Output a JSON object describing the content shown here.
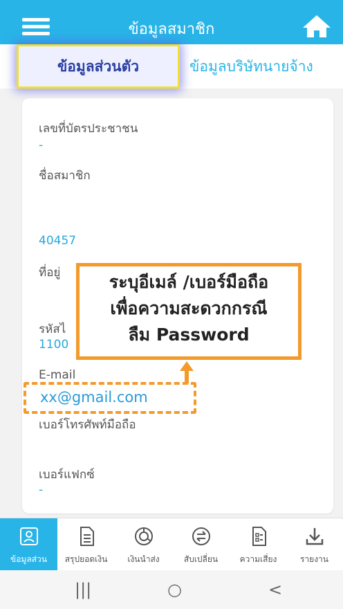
{
  "header": {
    "title": "ข้อมูลสมาชิก"
  },
  "tabs": [
    {
      "label": "ข้อมูลส่วนตัว"
    },
    {
      "label": "ข้อมูลบริษัทนายจ้าง"
    }
  ],
  "fields": {
    "id_card": {
      "label": "เลขที่บัตรประชาชน",
      "value": "-"
    },
    "member_name": {
      "label": "ชื่อสมาชิก",
      "value": "40457"
    },
    "address": {
      "label": "ที่อยู่"
    },
    "postal": {
      "label": "รหัสไ",
      "value": "1100"
    },
    "email": {
      "label": "E-mail",
      "value": "xx@gmail.com"
    },
    "mobile": {
      "label": "เบอร์โทรศัพท์มือถือ"
    },
    "fax": {
      "label": "เบอร์แฟกซ์",
      "value": "-"
    }
  },
  "callout": {
    "line1": "ระบุอีเมล์ /เบอร์มือถือ",
    "line2": "เพื่อความสะดวกกรณี",
    "line3": "ลืม Password"
  },
  "bottom_nav": [
    {
      "label": "ข้อมูลส่วน",
      "icon": "profile-card-icon"
    },
    {
      "label": "สรุปยอดเงิน",
      "icon": "document-icon"
    },
    {
      "label": "เงินนำส่ง",
      "icon": "pie-chart-icon"
    },
    {
      "label": "สับเปลี่ยน",
      "icon": "switch-icon"
    },
    {
      "label": "ความเสี่ยง",
      "icon": "risk-document-icon"
    },
    {
      "label": "รายงาน",
      "icon": "download-icon"
    }
  ],
  "system_nav": {
    "recents": "|||",
    "home": "○",
    "back": "<"
  },
  "colors": {
    "primary": "#29b4e8",
    "accent": "#f39a2b",
    "tab_text": "#2a3ea0"
  }
}
